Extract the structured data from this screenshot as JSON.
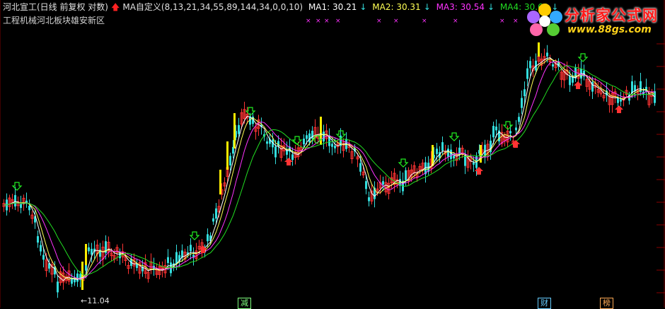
{
  "header": {
    "stock": "河北宣工(日线 前复权 对数)",
    "indicator": "MA自定义(8,13,21,34,55,89,144,34,0,0,10)",
    "ma1": "MA1: 30.21",
    "ma2": "MA2: 30.31",
    "ma3": "MA3: 30.54",
    "ma4": "MA4: 30.63",
    "sector": "工程机械河北板块雄安新区"
  },
  "logo": {
    "brand": "分析家公式网",
    "url": "www.88gs.com"
  },
  "low_label": "←11.04",
  "bottom_tags": [
    "减",
    "财",
    "榜"
  ],
  "colors": {
    "ma1": "#ffffff",
    "ma2": "#ffff55",
    "ma3": "#ff33ff",
    "ma4": "#22dd22",
    "up": "#ff3333",
    "down": "#33dddd",
    "signal": "#ffee00"
  },
  "chart_data": {
    "type": "candlestick",
    "scale": "log",
    "low_price": 11.04,
    "ma_series_names": [
      "MA1",
      "MA2",
      "MA3",
      "MA4"
    ],
    "ma_last_values": [
      30.21,
      30.31,
      30.54,
      30.63
    ]
  }
}
